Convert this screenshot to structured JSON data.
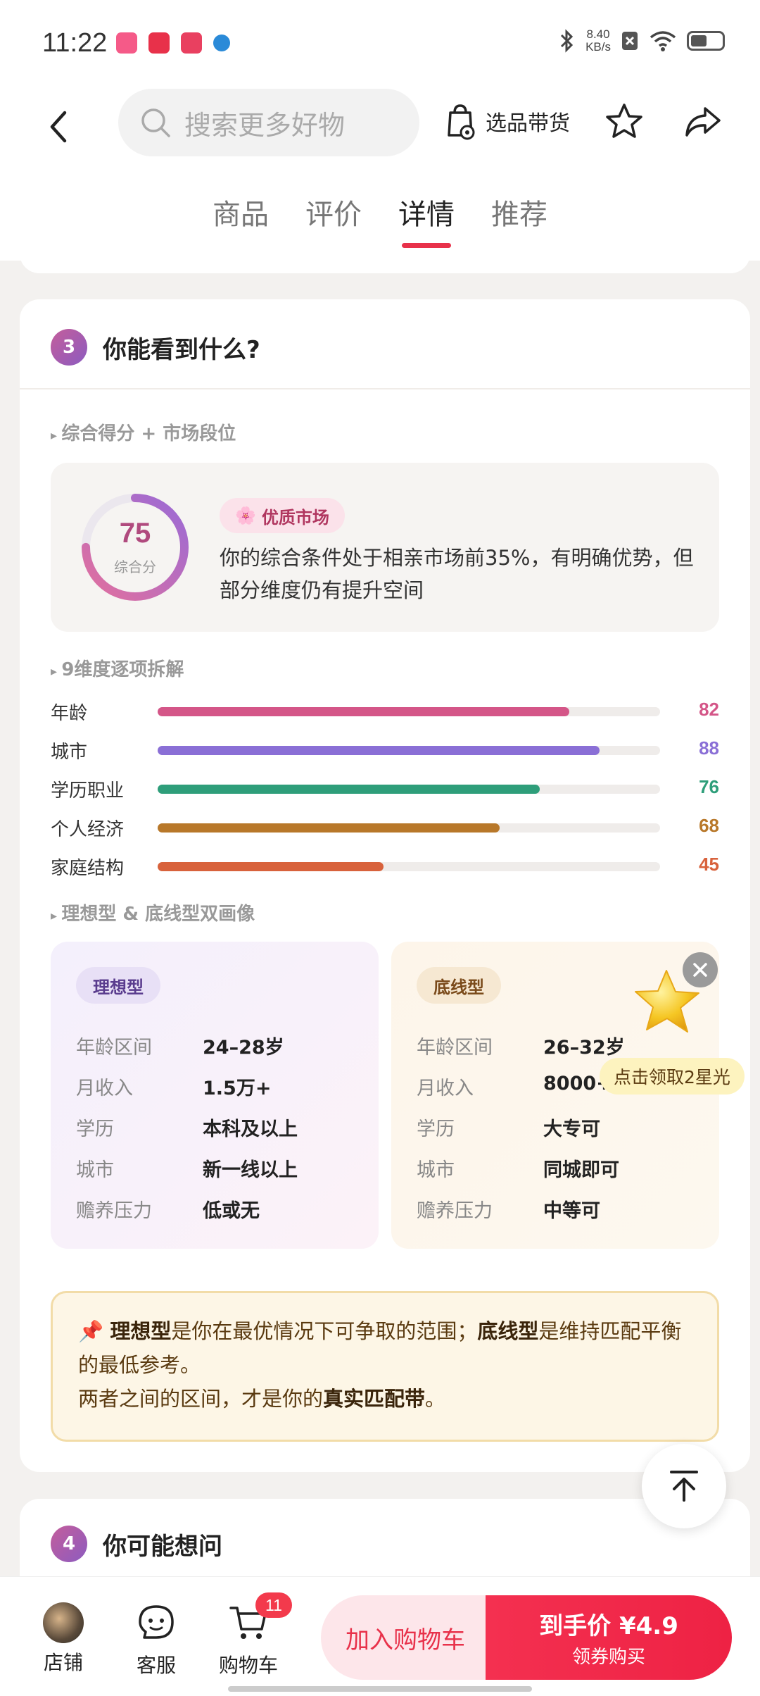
{
  "status_bar": {
    "time": "11:22",
    "net_speed_value": "8.40",
    "net_speed_unit": "KB/s",
    "battery_fraction": 0.45
  },
  "header": {
    "search_placeholder": "搜索更多好物",
    "pick_label": "选品带货",
    "tabs": [
      {
        "label": "商品"
      },
      {
        "label": "评价"
      },
      {
        "label": "详情",
        "active": true
      },
      {
        "label": "推荐"
      }
    ]
  },
  "section3": {
    "number": "3",
    "title": "你能看到什么?",
    "sub1": "综合得分 + 市场段位",
    "score": {
      "value": "75",
      "caption": "综合分",
      "fraction": 0.75,
      "badge": "优质市场",
      "description": "你的综合条件处于相亲市场前35%，有明确优势，但部分维度仍有提升空间"
    },
    "sub2": "9维度逐项拆解",
    "dimensions": [
      {
        "label": "年龄",
        "value": 82,
        "color": "#d45688"
      },
      {
        "label": "城市",
        "value": 88,
        "color": "#8a6fd6"
      },
      {
        "label": "学历职业",
        "value": 76,
        "color": "#2e9e7a"
      },
      {
        "label": "个人经济",
        "value": 68,
        "color": "#b8782a"
      },
      {
        "label": "家庭结构",
        "value": 45,
        "color": "#d8623c"
      }
    ],
    "sub3": "理想型 & 底线型双画像",
    "ideal": {
      "tag": "理想型",
      "rows": [
        {
          "k": "年龄区间",
          "v": "24–28岁"
        },
        {
          "k": "月收入",
          "v": "1.5万+"
        },
        {
          "k": "学历",
          "v": "本科及以上"
        },
        {
          "k": "城市",
          "v": "新一线以上"
        },
        {
          "k": "赡养压力",
          "v": "低或无"
        }
      ]
    },
    "base": {
      "tag": "底线型",
      "rows": [
        {
          "k": "年龄区间",
          "v": "26–32岁"
        },
        {
          "k": "月收入",
          "v": "8000+"
        },
        {
          "k": "学历",
          "v": "大专可"
        },
        {
          "k": "城市",
          "v": "同城即可"
        },
        {
          "k": "赡养压力",
          "v": "中等可"
        }
      ]
    },
    "star_bubble": "点击领取2星光",
    "note": {
      "pin": "📌",
      "ideal_word": "理想型",
      "p1": "是你在最优情况下可争取的范围；",
      "base_word": "底线型",
      "p2": "是维持匹配平衡的最低参考。",
      "p3": "两者之间的区间，才是你的",
      "band": "真实匹配带",
      "p4": "。"
    }
  },
  "section4": {
    "number": "4",
    "title": "你可能想问"
  },
  "bottom_bar": {
    "shop_label": "店铺",
    "service_label": "客服",
    "cart_label": "购物车",
    "cart_count": "11",
    "add_cart": "加入购物车",
    "buy_main": "到手价 ¥4.9",
    "buy_sub": "领券购买"
  }
}
